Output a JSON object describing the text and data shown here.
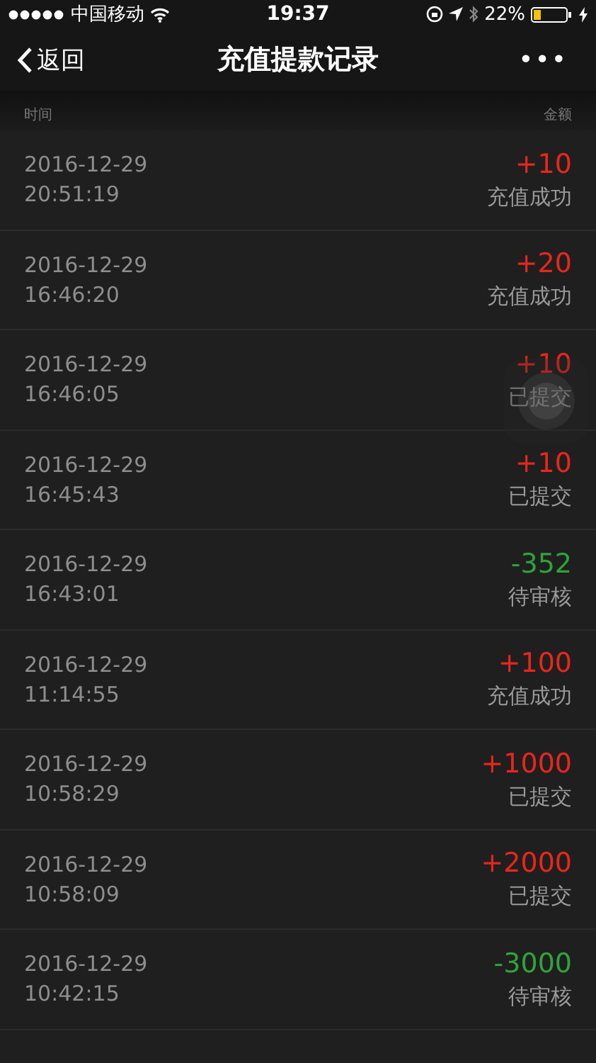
{
  "status_bar": {
    "carrier": "中国移动",
    "time": "19:37",
    "battery": "22%"
  },
  "nav": {
    "back": "返回",
    "title": "充值提款记录",
    "more": "•••"
  },
  "columns": [
    "时间",
    "金额"
  ],
  "records": [
    {
      "date": "2016-12-29",
      "time": "20:51:19",
      "amount": "+10",
      "status": "充值成功",
      "kind": "deposit"
    },
    {
      "date": "2016-12-29",
      "time": "16:46:20",
      "amount": "+20",
      "status": "充值成功",
      "kind": "deposit"
    },
    {
      "date": "2016-12-29",
      "time": "16:46:05",
      "amount": "+10",
      "status": "已提交",
      "kind": "deposit"
    },
    {
      "date": "2016-12-29",
      "time": "16:45:43",
      "amount": "+10",
      "status": "已提交",
      "kind": "deposit"
    },
    {
      "date": "2016-12-29",
      "time": "16:43:01",
      "amount": "-352",
      "status": "待审核",
      "kind": "withdrawal"
    },
    {
      "date": "2016-12-29",
      "time": "11:14:55",
      "amount": "+100",
      "status": "充值成功",
      "kind": "deposit"
    },
    {
      "date": "2016-12-29",
      "time": "10:58:29",
      "amount": "+1000",
      "status": "已提交",
      "kind": "deposit"
    },
    {
      "date": "2016-12-29",
      "time": "10:58:09",
      "amount": "+2000",
      "status": "已提交",
      "kind": "deposit"
    },
    {
      "date": "2016-12-29",
      "time": "10:42:15",
      "amount": "-3000",
      "status": "待审核",
      "kind": "withdrawal"
    }
  ]
}
